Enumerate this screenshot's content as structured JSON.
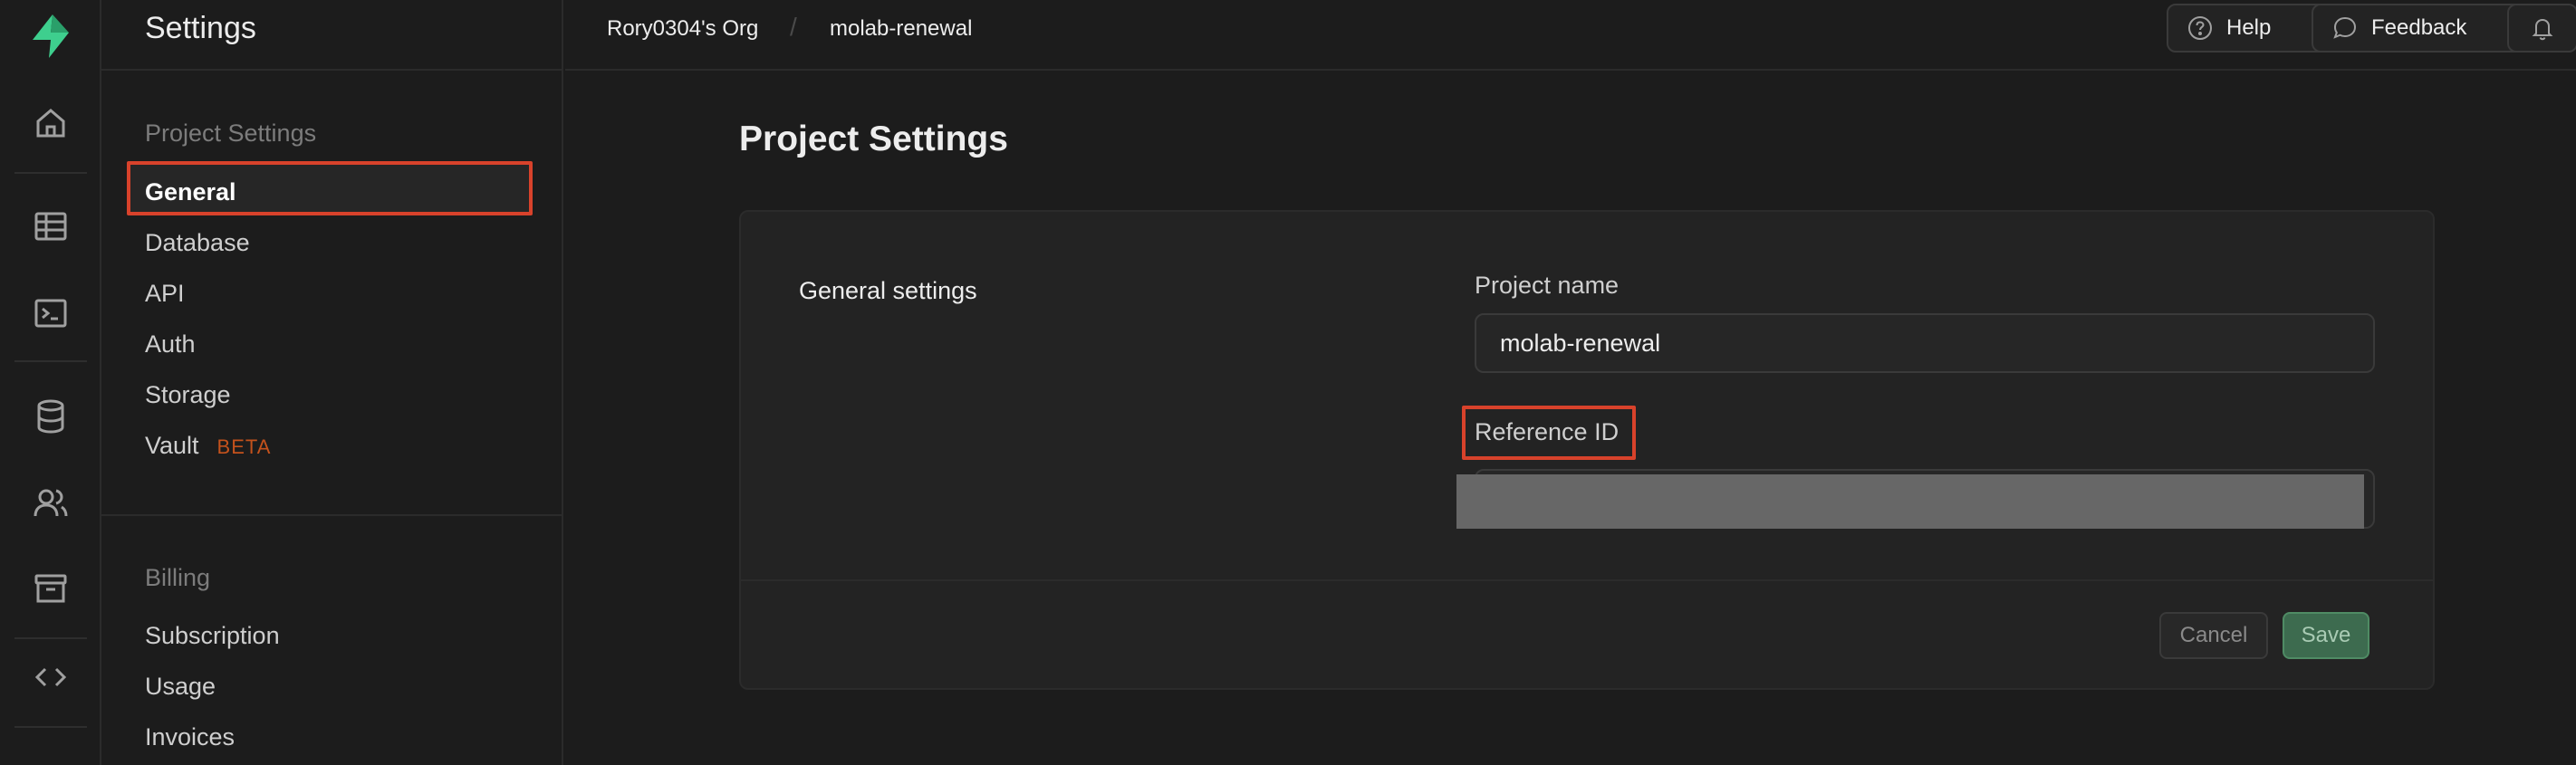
{
  "menu": {
    "title": "Settings",
    "project_section": "Project Settings",
    "project_items": [
      {
        "label": "General"
      },
      {
        "label": "Database"
      },
      {
        "label": "API"
      },
      {
        "label": "Auth"
      },
      {
        "label": "Storage"
      },
      {
        "label": "Vault",
        "badge": "BETA"
      }
    ],
    "billing_section": "Billing",
    "billing_items": [
      {
        "label": "Subscription"
      },
      {
        "label": "Usage"
      },
      {
        "label": "Invoices"
      }
    ]
  },
  "topbar": {
    "org": "Rory0304's Org",
    "separator": "/",
    "project": "molab-renewal",
    "help_label": "Help",
    "feedback_label": "Feedback"
  },
  "main": {
    "page_title": "Project Settings",
    "section_title": "General settings",
    "project_name_label": "Project name",
    "project_name_value": "molab-renewal",
    "reference_id_label": "Reference ID",
    "cancel_label": "Cancel",
    "save_label": "Save"
  },
  "colors": {
    "accent_green": "#3ecf8e",
    "highlight_red": "#d8422b",
    "beta_orange": "#c4521c"
  },
  "icons": {
    "rail": [
      "logo-icon",
      "home-icon",
      "table-editor-icon",
      "sql-editor-icon",
      "database-icon",
      "auth-users-icon",
      "storage-icon",
      "api-code-icon"
    ],
    "topbar": [
      "help-icon",
      "feedback-icon",
      "bell-icon"
    ]
  }
}
